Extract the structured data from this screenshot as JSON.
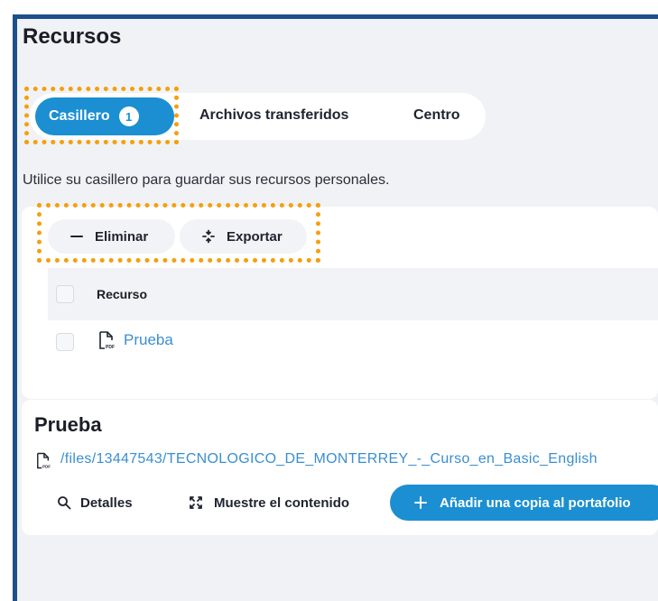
{
  "page": {
    "title": "Recursos"
  },
  "tabs": {
    "active": {
      "label": "Casillero",
      "count": "1"
    },
    "items": [
      {
        "label": "Archivos transferidos"
      },
      {
        "label": "Centro"
      }
    ]
  },
  "description": "Utilice su casillero para guardar sus recursos personales.",
  "toolbar": {
    "delete_label": "Eliminar",
    "export_label": "Exportar"
  },
  "table": {
    "header": "Recurso",
    "rows": [
      {
        "name": "Prueba",
        "icon": "pdf-file-icon"
      }
    ]
  },
  "detail": {
    "title": "Prueba",
    "path": "/files/13447543/TECNOLOGICO_DE_MONTERREY_-_Curso_en_Basic_English",
    "details_label": "Detalles",
    "show_label": "Muestre el contenido",
    "add_label": "Añadir una copia al portafolio"
  },
  "colors": {
    "accent": "#1b8fd1",
    "highlight": "#f59f0c",
    "frame": "#1d4f8c",
    "link": "#3a8fd0"
  }
}
